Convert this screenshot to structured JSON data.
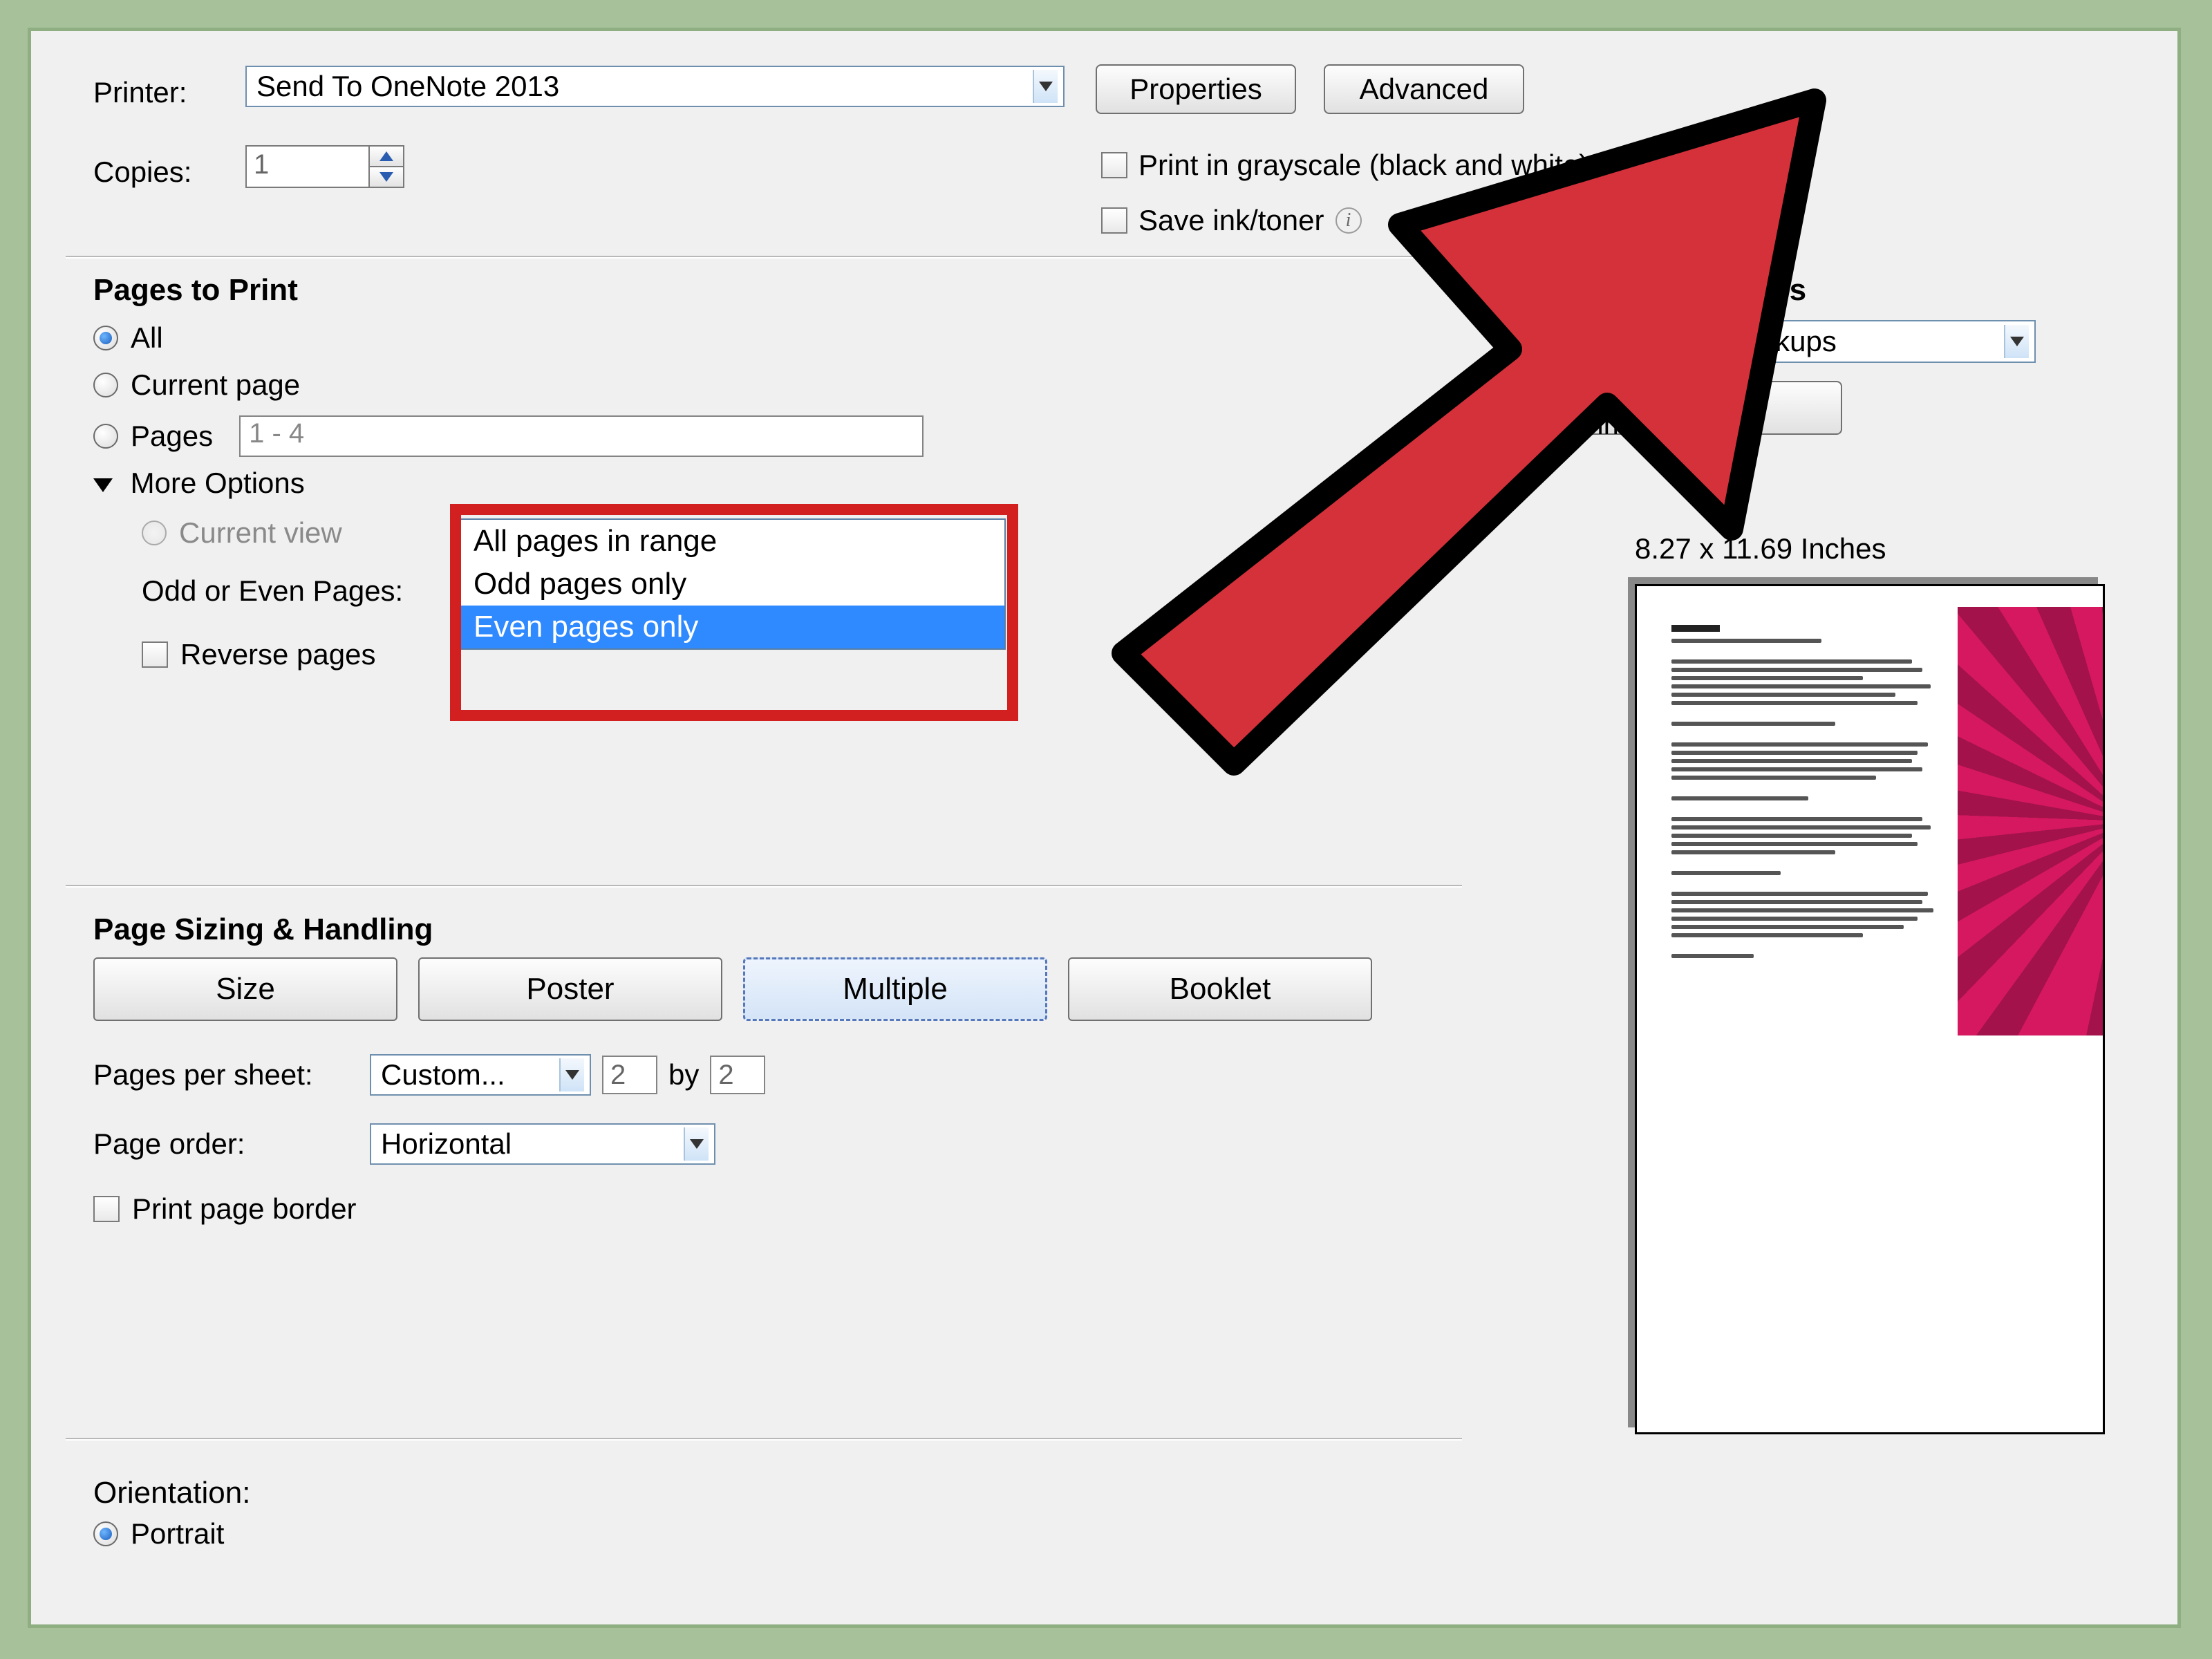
{
  "printer": {
    "label": "Printer:",
    "selected": "Send To OneNote 2013",
    "copies_label": "Copies:",
    "copies_value": "1",
    "properties_button": "Properties",
    "advanced_button": "Advanced",
    "grayscale_label": "Print in grayscale (black and white)",
    "save_ink_label": "Save ink/toner"
  },
  "pages": {
    "header": "Pages to Print",
    "all_label": "All",
    "current_page_label": "Current page",
    "pages_label": "Pages",
    "pages_range": "1 - 4",
    "more_options_label": "More Options",
    "current_view_label": "Current view",
    "odd_even_label": "Odd or Even Pages:",
    "odd_even_selected": "Even pages only",
    "odd_even_options": [
      "All pages in range",
      "Odd pages only",
      "Even pages only"
    ],
    "reverse_label": "Reverse pages"
  },
  "sizing": {
    "header": "Page Sizing & Handling",
    "buttons": {
      "size": "Size",
      "poster": "Poster",
      "multiple": "Multiple",
      "booklet": "Booklet"
    },
    "pages_per_sheet_label": "Pages per sheet:",
    "pages_per_sheet_value": "Custom...",
    "grid_x": "2",
    "by_label": "by",
    "grid_y": "2",
    "page_order_label": "Page order:",
    "page_order_value": "Horizontal",
    "print_border_label": "Print page border"
  },
  "orientation": {
    "header": "Orientation:",
    "portrait_label": "Portrait"
  },
  "comments": {
    "header": "Comments & Forms",
    "mode": "Document and Markups",
    "summarize_button": "Summarize Comments"
  },
  "preview": {
    "dimensions": "8.27 x 11.69 Inches"
  }
}
